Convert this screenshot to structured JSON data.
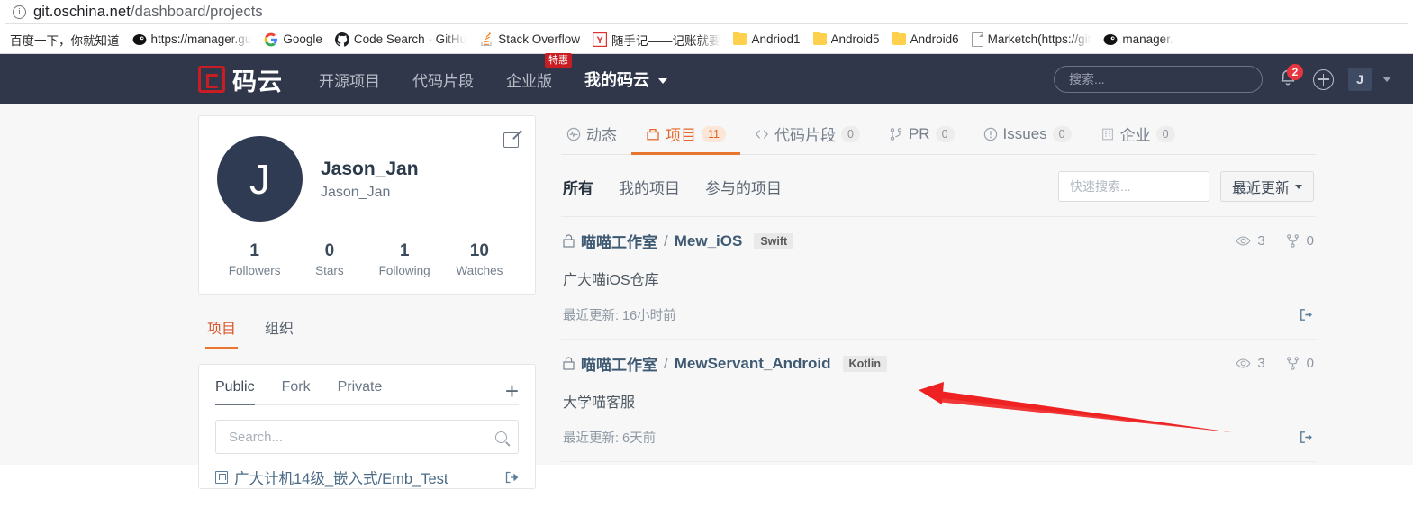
{
  "browser": {
    "url": {
      "host": "git.oschina.net",
      "path": "/dashboard/projects"
    },
    "info_icon": "info-circle-icon",
    "bookmarks": [
      {
        "label": "百度一下，你就知道",
        "icon": "none"
      },
      {
        "label": "https://manager.gu",
        "icon": "bird-icon"
      },
      {
        "label": "Google",
        "icon": "google-icon"
      },
      {
        "label": "Code Search · GitHu",
        "icon": "github-icon"
      },
      {
        "label": "Stack Overflow",
        "icon": "stackoverflow-icon"
      },
      {
        "label": "随手记——记账就要",
        "icon": "yi-icon"
      },
      {
        "label": "Andriod1",
        "icon": "folder-icon"
      },
      {
        "label": "Android5",
        "icon": "folder-icon"
      },
      {
        "label": "Android6",
        "icon": "folder-icon"
      },
      {
        "label": "Marketch(https://git",
        "icon": "document-icon"
      },
      {
        "label": "manager.",
        "icon": "bird-icon"
      }
    ]
  },
  "navbar": {
    "brand": "码云",
    "links": [
      {
        "label": "开源项目",
        "badge": ""
      },
      {
        "label": "代码片段",
        "badge": ""
      },
      {
        "label": "企业版",
        "badge": "特惠"
      }
    ],
    "my_gitee": "我的码云",
    "search_placeholder": "搜索...",
    "search_value": "",
    "notification_count": "2",
    "avatar_letter": "J"
  },
  "sidebar": {
    "profile": {
      "avatar_letter": "J",
      "display_name": "Jason_Jan",
      "login": "Jason_Jan",
      "edit_icon": "edit-pencil-icon",
      "stats": [
        {
          "num": "1",
          "label": "Followers"
        },
        {
          "num": "0",
          "label": "Stars"
        },
        {
          "num": "1",
          "label": "Following"
        },
        {
          "num": "10",
          "label": "Watches"
        }
      ]
    },
    "tabs": [
      {
        "label": "项目",
        "active": true
      },
      {
        "label": "组织",
        "active": false
      }
    ],
    "repo_filters": [
      {
        "label": "Public",
        "active": true
      },
      {
        "label": "Fork",
        "active": false
      },
      {
        "label": "Private",
        "active": false
      }
    ],
    "add_label": "+",
    "search_placeholder": "Search...",
    "search_value": "",
    "repos": [
      {
        "name": "广大计机14级_嵌入式/Emb_Test"
      }
    ]
  },
  "main": {
    "tabs": [
      {
        "label": "动态",
        "count": "",
        "icon": "activity-icon",
        "active": false
      },
      {
        "label": "项目",
        "count": "11",
        "icon": "repo-icon",
        "active": true
      },
      {
        "label": "代码片段",
        "count": "0",
        "icon": "code-icon",
        "active": false
      },
      {
        "label": "PR",
        "count": "0",
        "icon": "pull-request-icon",
        "active": false
      },
      {
        "label": "Issues",
        "count": "0",
        "icon": "issue-icon",
        "active": false
      },
      {
        "label": "企业",
        "count": "0",
        "icon": "building-icon",
        "active": false
      }
    ],
    "filters": [
      {
        "label": "所有",
        "active": true
      },
      {
        "label": "我的项目",
        "active": false
      },
      {
        "label": "参与的项目",
        "active": false
      }
    ],
    "quick_search_placeholder": "快速搜索...",
    "quick_search_value": "",
    "sort_label": "最近更新",
    "repos": [
      {
        "owner": "喵喵工作室",
        "separator": "/",
        "name": "Mew_iOS",
        "language": "Swift",
        "watches": "3",
        "forks": "0",
        "description": "广大喵iOS仓库",
        "updated": "最近更新: 16小时前"
      },
      {
        "owner": "喵喵工作室",
        "separator": "/",
        "name": "MewServant_Android",
        "language": "Kotlin",
        "watches": "3",
        "forks": "0",
        "description": "大学喵客服",
        "updated": "最近更新: 6天前"
      }
    ]
  },
  "annotation": {
    "type": "red-arrow",
    "color": "#ee2222",
    "points_to": "Kotlin language tag"
  }
}
